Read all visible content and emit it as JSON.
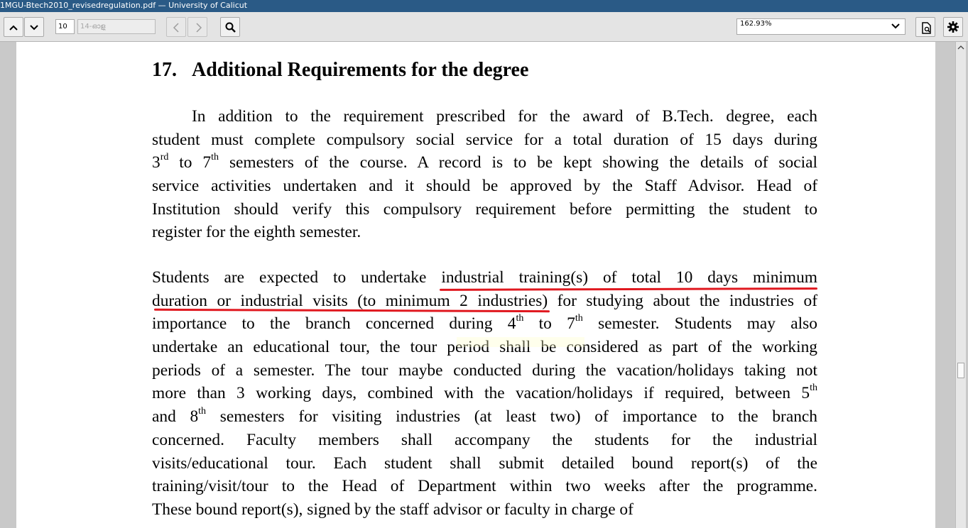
{
  "window": {
    "title": "1MGU-Btech2010_revisedregulation.pdf — University of Calicut"
  },
  "toolbar": {
    "page_number": "10",
    "page_label": "14-ഓളു",
    "zoom": "162.93%",
    "icons": [
      "chevron-up-icon",
      "chevron-down-icon",
      "arrow-left-icon",
      "arrow-right-icon",
      "search-icon",
      "document-icon",
      "gear-icon"
    ]
  },
  "doc": {
    "heading_number": "17.",
    "heading_text": "Additional Requirements for the degree",
    "para1": [
      "In addition to the requirement prescribed for the award of B.Tech. degree, each",
      "student must complete compulsory social service for a total duration of 15 days during",
      [
        "3",
        "rd",
        " to 7",
        "th",
        " semesters of the course. A record is to be kept showing the details of social"
      ],
      "service activities undertaken and it should be approved by the Staff Advisor. Head of",
      "Institution should verify this compulsory requirement before permitting the student to",
      "register for the eighth semester."
    ],
    "para2": [
      "Students are expected to undertake industrial training(s) of total 10 days minimum",
      "duration or industrial visits (to minimum 2 industries) for studying about the industries of",
      [
        "importance to the branch concerned during 4",
        "th",
        " to 7",
        "th",
        " semester. Students may also"
      ],
      "undertake an educational tour, the tour period shall be considered as part of the working",
      "periods of a semester. The tour maybe conducted during the vacation/holidays taking not",
      [
        "more than 3 working days, combined with the vacation/holidays if required, between 5",
        "th"
      ],
      [
        "and 8",
        "th",
        " semesters for visiting industries (at least two) of importance to the branch"
      ],
      "concerned. Faculty members shall accompany the students for the industrial",
      "visits/educational tour. Each student shall submit detailed bound report(s) of the",
      "training/visit/tour to the Head of Department within two weeks after the programme.",
      "These bound report(s), signed by the staff advisor or faculty in charge of"
    ],
    "annotation_color": "#e0181f"
  }
}
